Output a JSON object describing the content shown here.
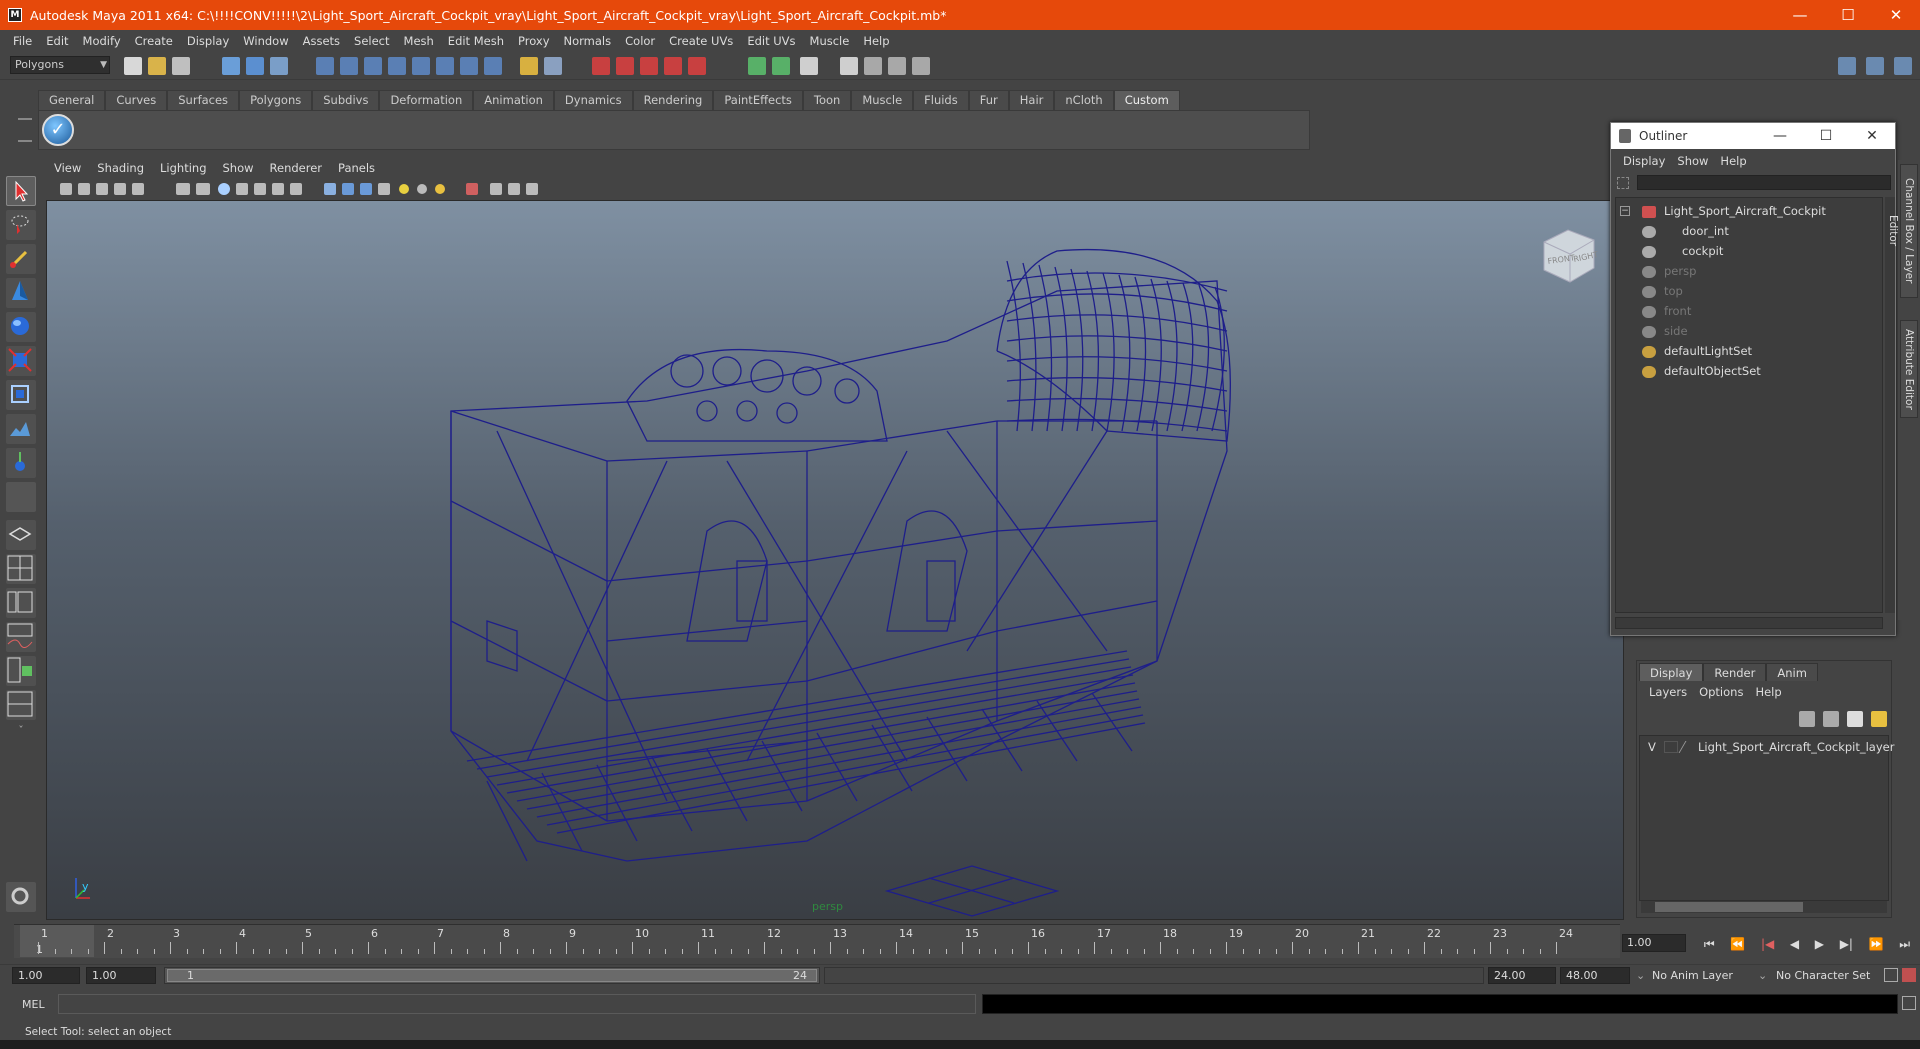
{
  "window": {
    "title": "Autodesk Maya 2011 x64: C:\\!!!!CONV!!!!!\\2\\Light_Sport_Aircraft_Cockpit_vray\\Light_Sport_Aircraft_Cockpit_vray\\Light_Sport_Aircraft_Cockpit.mb*",
    "minimize": "—",
    "maximize": "☐",
    "close": "✕"
  },
  "menus": [
    "File",
    "Edit",
    "Modify",
    "Create",
    "Display",
    "Window",
    "Assets",
    "Select",
    "Mesh",
    "Edit Mesh",
    "Proxy",
    "Normals",
    "Color",
    "Create UVs",
    "Edit UVs",
    "Muscle",
    "Help"
  ],
  "mode_selector": "Polygons",
  "shelf": {
    "tabs": [
      "General",
      "Curves",
      "Surfaces",
      "Polygons",
      "Subdivs",
      "Deformation",
      "Animation",
      "Dynamics",
      "Rendering",
      "PaintEffects",
      "Toon",
      "Muscle",
      "Fluids",
      "Fur",
      "Hair",
      "nCloth",
      "Custom"
    ],
    "active_tab": "Custom"
  },
  "panel_menus": [
    "View",
    "Shading",
    "Lighting",
    "Show",
    "Renderer",
    "Panels"
  ],
  "viewport": {
    "camera_label": "persp",
    "viewcube_front": "FRONT",
    "viewcube_right": "RIGHT",
    "axis_y": "y",
    "wire_color": "#1e1e8a"
  },
  "timeline": {
    "ticks": [
      "1",
      "2",
      "3",
      "4",
      "5",
      "6",
      "7",
      "8",
      "9",
      "10",
      "11",
      "12",
      "13",
      "14",
      "15",
      "16",
      "17",
      "18",
      "19",
      "20",
      "21",
      "22",
      "23",
      "24"
    ],
    "current_frame_label": "1",
    "current_time": "1.00"
  },
  "range": {
    "start_time": "1.00",
    "playback_start": "1.00",
    "slider_start": "1",
    "slider_end": "24",
    "playback_end": "24.00",
    "end_time": "48.00",
    "anim_layer": "No Anim Layer",
    "character_set": "No Character Set"
  },
  "command": {
    "label": "MEL"
  },
  "help_line": "Select Tool: select an object",
  "outliner": {
    "title": "Outliner",
    "menus": [
      "Display",
      "Show",
      "Help"
    ],
    "items": [
      {
        "label": "Light_Sport_Aircraft_Cockpit",
        "dim": false
      },
      {
        "label": "door_int",
        "dim": false
      },
      {
        "label": "cockpit",
        "dim": false
      },
      {
        "label": "persp",
        "dim": true
      },
      {
        "label": "top",
        "dim": true
      },
      {
        "label": "front",
        "dim": true
      },
      {
        "label": "side",
        "dim": true
      },
      {
        "label": "defaultLightSet",
        "dim": false
      },
      {
        "label": "defaultObjectSet",
        "dim": false
      }
    ]
  },
  "layer_editor": {
    "tabs": [
      "Display",
      "Render",
      "Anim"
    ],
    "active_tab": "Display",
    "menus": [
      "Layers",
      "Options",
      "Help"
    ],
    "layer_visibility": "V",
    "layer_name": "Light_Sport_Aircraft_Cockpit_layer"
  },
  "side_tabs": {
    "channel_box": "Channel Box / Layer Editor",
    "attribute_editor": "Attribute Editor"
  },
  "playback_controls": [
    "⏮",
    "⏪",
    "|◀",
    "◀",
    "▶",
    "▶|",
    "⏩",
    "⏭"
  ]
}
